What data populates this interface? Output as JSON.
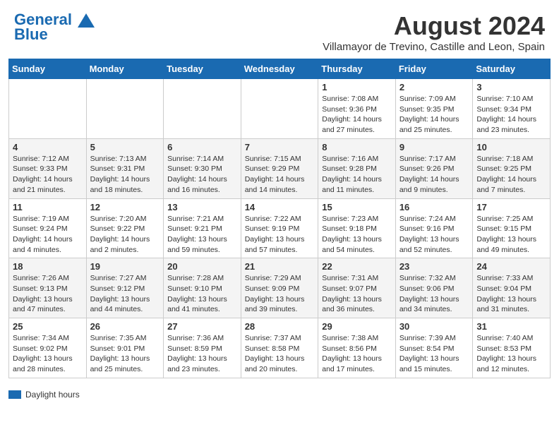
{
  "header": {
    "logo_line1": "General",
    "logo_line2": "Blue",
    "month_title": "August 2024",
    "subtitle": "Villamayor de Trevino, Castille and Leon, Spain"
  },
  "days_of_week": [
    "Sunday",
    "Monday",
    "Tuesday",
    "Wednesday",
    "Thursday",
    "Friday",
    "Saturday"
  ],
  "weeks": [
    [
      {
        "num": "",
        "info": ""
      },
      {
        "num": "",
        "info": ""
      },
      {
        "num": "",
        "info": ""
      },
      {
        "num": "",
        "info": ""
      },
      {
        "num": "1",
        "info": "Sunrise: 7:08 AM\nSunset: 9:36 PM\nDaylight: 14 hours and 27 minutes."
      },
      {
        "num": "2",
        "info": "Sunrise: 7:09 AM\nSunset: 9:35 PM\nDaylight: 14 hours and 25 minutes."
      },
      {
        "num": "3",
        "info": "Sunrise: 7:10 AM\nSunset: 9:34 PM\nDaylight: 14 hours and 23 minutes."
      }
    ],
    [
      {
        "num": "4",
        "info": "Sunrise: 7:12 AM\nSunset: 9:33 PM\nDaylight: 14 hours and 21 minutes."
      },
      {
        "num": "5",
        "info": "Sunrise: 7:13 AM\nSunset: 9:31 PM\nDaylight: 14 hours and 18 minutes."
      },
      {
        "num": "6",
        "info": "Sunrise: 7:14 AM\nSunset: 9:30 PM\nDaylight: 14 hours and 16 minutes."
      },
      {
        "num": "7",
        "info": "Sunrise: 7:15 AM\nSunset: 9:29 PM\nDaylight: 14 hours and 14 minutes."
      },
      {
        "num": "8",
        "info": "Sunrise: 7:16 AM\nSunset: 9:28 PM\nDaylight: 14 hours and 11 minutes."
      },
      {
        "num": "9",
        "info": "Sunrise: 7:17 AM\nSunset: 9:26 PM\nDaylight: 14 hours and 9 minutes."
      },
      {
        "num": "10",
        "info": "Sunrise: 7:18 AM\nSunset: 9:25 PM\nDaylight: 14 hours and 7 minutes."
      }
    ],
    [
      {
        "num": "11",
        "info": "Sunrise: 7:19 AM\nSunset: 9:24 PM\nDaylight: 14 hours and 4 minutes."
      },
      {
        "num": "12",
        "info": "Sunrise: 7:20 AM\nSunset: 9:22 PM\nDaylight: 14 hours and 2 minutes."
      },
      {
        "num": "13",
        "info": "Sunrise: 7:21 AM\nSunset: 9:21 PM\nDaylight: 13 hours and 59 minutes."
      },
      {
        "num": "14",
        "info": "Sunrise: 7:22 AM\nSunset: 9:19 PM\nDaylight: 13 hours and 57 minutes."
      },
      {
        "num": "15",
        "info": "Sunrise: 7:23 AM\nSunset: 9:18 PM\nDaylight: 13 hours and 54 minutes."
      },
      {
        "num": "16",
        "info": "Sunrise: 7:24 AM\nSunset: 9:16 PM\nDaylight: 13 hours and 52 minutes."
      },
      {
        "num": "17",
        "info": "Sunrise: 7:25 AM\nSunset: 9:15 PM\nDaylight: 13 hours and 49 minutes."
      }
    ],
    [
      {
        "num": "18",
        "info": "Sunrise: 7:26 AM\nSunset: 9:13 PM\nDaylight: 13 hours and 47 minutes."
      },
      {
        "num": "19",
        "info": "Sunrise: 7:27 AM\nSunset: 9:12 PM\nDaylight: 13 hours and 44 minutes."
      },
      {
        "num": "20",
        "info": "Sunrise: 7:28 AM\nSunset: 9:10 PM\nDaylight: 13 hours and 41 minutes."
      },
      {
        "num": "21",
        "info": "Sunrise: 7:29 AM\nSunset: 9:09 PM\nDaylight: 13 hours and 39 minutes."
      },
      {
        "num": "22",
        "info": "Sunrise: 7:31 AM\nSunset: 9:07 PM\nDaylight: 13 hours and 36 minutes."
      },
      {
        "num": "23",
        "info": "Sunrise: 7:32 AM\nSunset: 9:06 PM\nDaylight: 13 hours and 34 minutes."
      },
      {
        "num": "24",
        "info": "Sunrise: 7:33 AM\nSunset: 9:04 PM\nDaylight: 13 hours and 31 minutes."
      }
    ],
    [
      {
        "num": "25",
        "info": "Sunrise: 7:34 AM\nSunset: 9:02 PM\nDaylight: 13 hours and 28 minutes."
      },
      {
        "num": "26",
        "info": "Sunrise: 7:35 AM\nSunset: 9:01 PM\nDaylight: 13 hours and 25 minutes."
      },
      {
        "num": "27",
        "info": "Sunrise: 7:36 AM\nSunset: 8:59 PM\nDaylight: 13 hours and 23 minutes."
      },
      {
        "num": "28",
        "info": "Sunrise: 7:37 AM\nSunset: 8:58 PM\nDaylight: 13 hours and 20 minutes."
      },
      {
        "num": "29",
        "info": "Sunrise: 7:38 AM\nSunset: 8:56 PM\nDaylight: 13 hours and 17 minutes."
      },
      {
        "num": "30",
        "info": "Sunrise: 7:39 AM\nSunset: 8:54 PM\nDaylight: 13 hours and 15 minutes."
      },
      {
        "num": "31",
        "info": "Sunrise: 7:40 AM\nSunset: 8:53 PM\nDaylight: 13 hours and 12 minutes."
      }
    ]
  ],
  "legend": {
    "color": "#1a6ab1",
    "label": "Daylight hours"
  }
}
